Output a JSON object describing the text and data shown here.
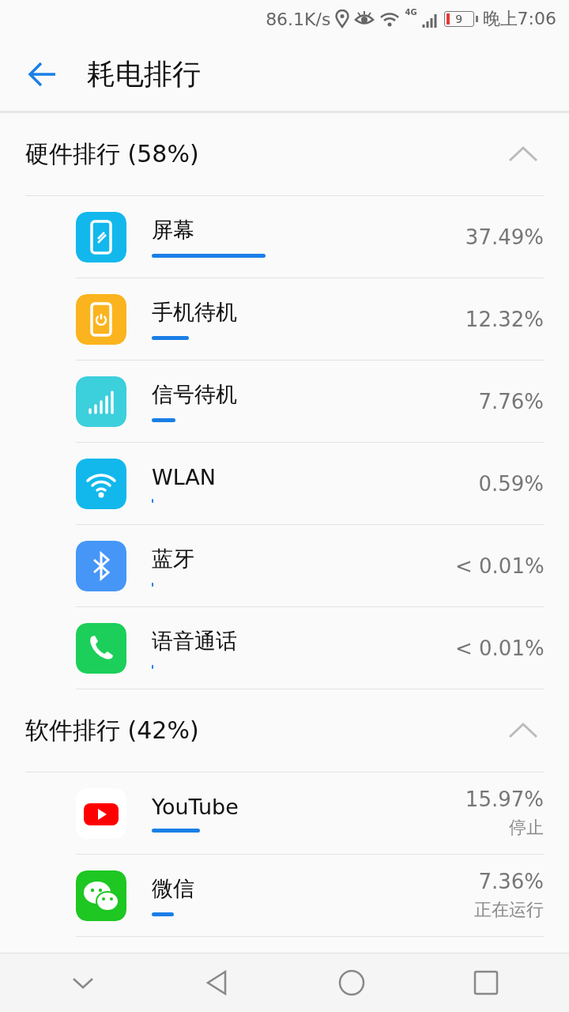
{
  "status_bar": {
    "speed": "86.1K/s",
    "network": "4G",
    "battery": "9",
    "time": "晚上7:06"
  },
  "header": {
    "title": "耗电排行"
  },
  "sections": [
    {
      "title": "硬件排行 (58%)",
      "expanded": true,
      "items": [
        {
          "kind": "screen",
          "name": "屏幕",
          "percent": "37.49%"
        },
        {
          "kind": "standby",
          "name": "手机待机",
          "percent": "12.32%"
        },
        {
          "kind": "signal",
          "name": "信号待机",
          "percent": "7.76%"
        },
        {
          "kind": "wifi",
          "name": "WLAN",
          "percent": "0.59%"
        },
        {
          "kind": "bluetooth",
          "name": "蓝牙",
          "percent": "< 0.01%"
        },
        {
          "kind": "phone",
          "name": "语音通话",
          "percent": "< 0.01%"
        }
      ]
    },
    {
      "title": "软件排行 (42%)",
      "expanded": true,
      "items": [
        {
          "kind": "video",
          "name": "YouTube",
          "percent": "15.97%",
          "status": "停止"
        },
        {
          "kind": "chat",
          "name": "微信",
          "percent": "7.36%",
          "status": "正在运行"
        }
      ]
    }
  ]
}
